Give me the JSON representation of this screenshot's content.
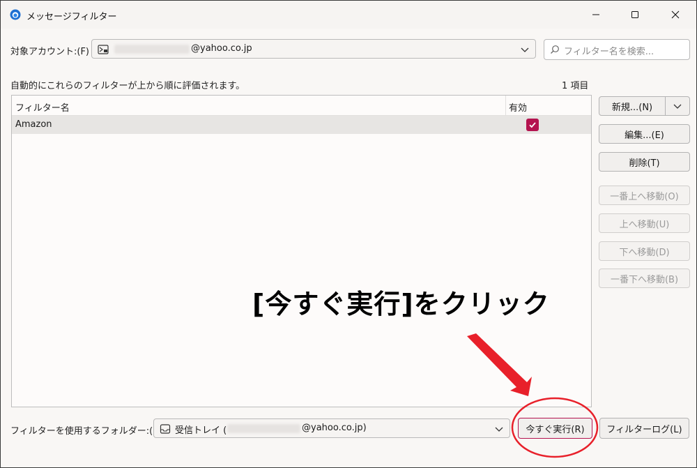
{
  "window": {
    "title": "メッセージフィルター"
  },
  "account": {
    "label": "対象アカウント:(F)",
    "value_suffix": "@yahoo.co.jp",
    "search_placeholder": "フィルター名を検索..."
  },
  "list": {
    "description": "自動的にこれらのフィルターが上から順に評価されます。",
    "count": "1 項目",
    "columns": {
      "name": "フィルター名",
      "enabled": "有効"
    },
    "rows": [
      {
        "name": "Amazon",
        "enabled": true
      }
    ]
  },
  "buttons": {
    "new": "新規...(N)",
    "edit": "編集...(E)",
    "delete": "削除(T)",
    "move_top": "一番上へ移動(O)",
    "move_up": "上へ移動(U)",
    "move_down": "下へ移動(D)",
    "move_bottom": "一番下へ移動(B)",
    "run_now": "今すぐ実行(R)",
    "filter_log": "フィルターログ(L)"
  },
  "folder": {
    "label": "フィルターを使用するフォルダー:(C)",
    "prefix": "受信トレイ (",
    "suffix": "@yahoo.co.jp)"
  },
  "annotation": {
    "text": "[今すぐ実行]をクリック",
    "color": "#e8202a"
  },
  "colors": {
    "accent": "#b4134f",
    "annotation": "#e8202a"
  },
  "icons": [
    "app-icon",
    "minimize-icon",
    "maximize-icon",
    "close-icon",
    "account-icon",
    "chevron-down-icon",
    "search-icon",
    "checkbox-checked-icon",
    "inbox-icon"
  ]
}
